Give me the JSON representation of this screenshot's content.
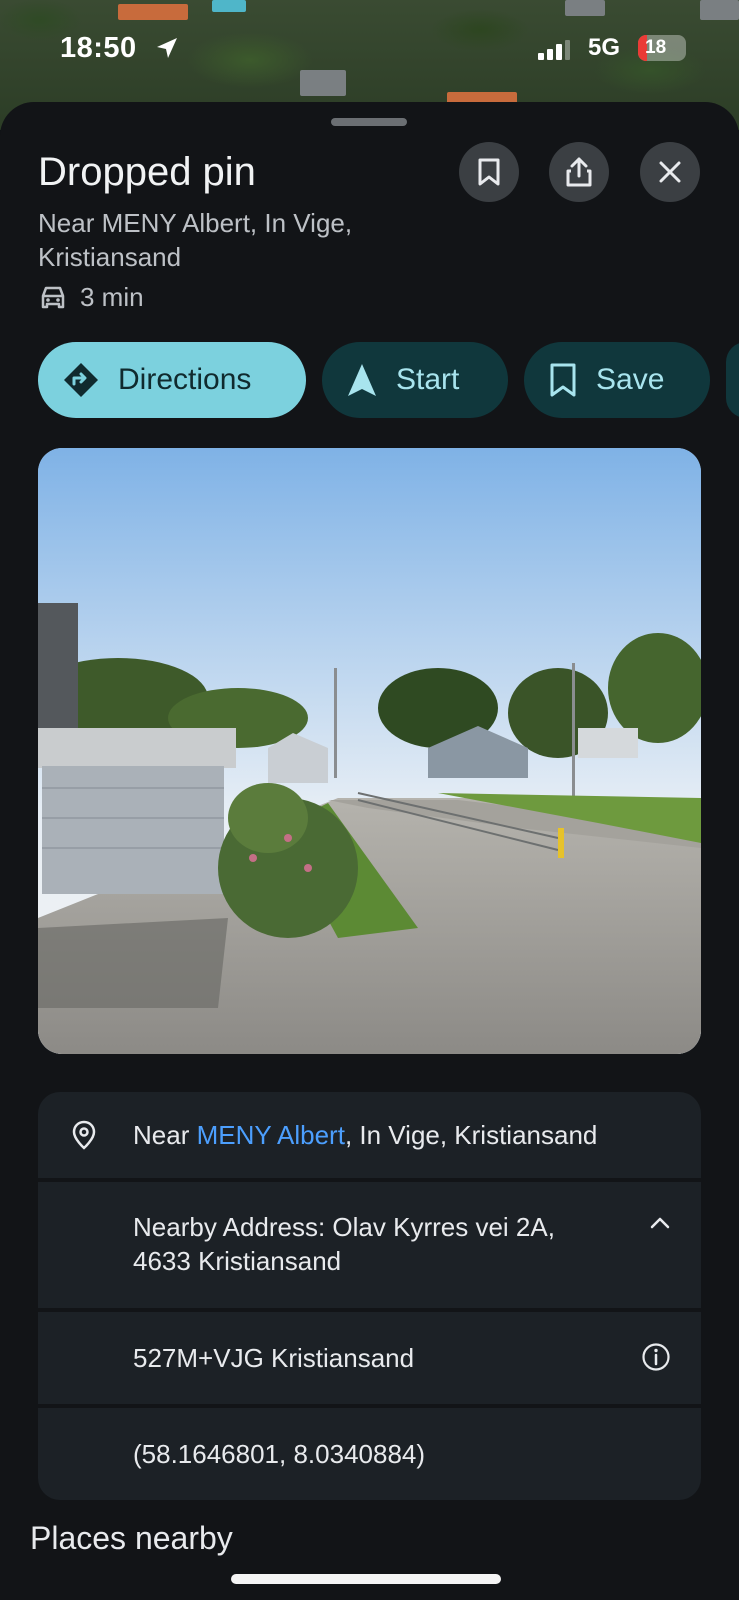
{
  "status_bar": {
    "time": "18:50",
    "network": "5G",
    "battery": "18"
  },
  "place": {
    "title": "Dropped pin",
    "subtitle": "Near MENY Albert, In Vige, Kristiansand",
    "drive_time": "3 min"
  },
  "header_buttons": [
    {
      "name": "save-icon"
    },
    {
      "name": "share-icon"
    },
    {
      "name": "close-icon"
    }
  ],
  "actions": {
    "directions": "Directions",
    "start": "Start",
    "save": "Save"
  },
  "info": {
    "near_prefix": "Near ",
    "near_link": "MENY Albert",
    "near_suffix": ", In Vige, Kristiansand",
    "nearby_address_line1": "Nearby Address: Olav Kyrres vei 2A,",
    "nearby_address_line2": "4633 Kristiansand",
    "plus_code": "527M+VJG Kristiansand",
    "coordinates": "(58.1646801, 8.0340884)"
  },
  "section": {
    "places_nearby": "Places nearby"
  },
  "colors": {
    "sheet_bg": "#121417",
    "primary_chip": "#7cd1de",
    "secondary_chip": "#10373c",
    "link": "#4c9ffe"
  }
}
